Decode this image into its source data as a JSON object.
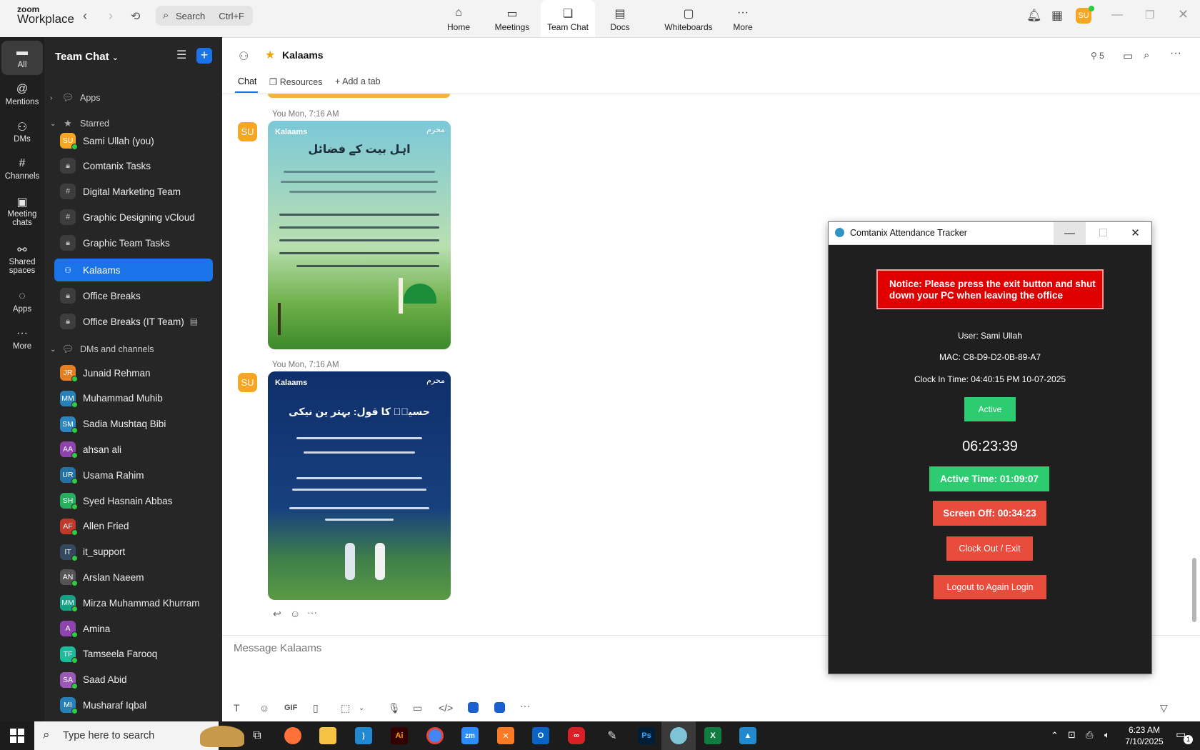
{
  "app": {
    "logo_line1": "zoom",
    "logo_line2": "Workplace"
  },
  "topbar": {
    "search_placeholder": "Search",
    "search_shortcut": "Ctrl+F",
    "nav": [
      {
        "label": "Home",
        "icon": "home-icon"
      },
      {
        "label": "Meetings",
        "icon": "video-camera-icon"
      },
      {
        "label": "Team Chat",
        "icon": "chat-bubbles-icon"
      },
      {
        "label": "Docs",
        "icon": "document-icon"
      },
      {
        "label": "Whiteboards",
        "icon": "whiteboard-icon"
      },
      {
        "label": "More",
        "icon": "more-dots-icon"
      }
    ],
    "user_initials": "SU"
  },
  "rail": [
    {
      "label": "All",
      "icon": "chat-bubble-icon"
    },
    {
      "label": "Mentions",
      "icon": "at-sign-icon"
    },
    {
      "label": "DMs",
      "icon": "people-icon"
    },
    {
      "label": "Channels",
      "icon": "hashtag-icon"
    },
    {
      "label": "Meeting chats",
      "icon": "calendar-icon"
    },
    {
      "label": "Shared spaces",
      "icon": "shared-spaces-icon"
    },
    {
      "label": "Apps",
      "icon": "apps-bubble-icon"
    },
    {
      "label": "More",
      "icon": "more-dots-icon"
    }
  ],
  "sidebar": {
    "title": "Team Chat",
    "sections": {
      "apps": "Apps",
      "starred": "Starred",
      "dms": "DMs and channels"
    },
    "starred": [
      {
        "label": "Sami Ullah (you)",
        "type": "avatar",
        "initials": "SU",
        "color": "#f5a623"
      },
      {
        "label": "Comtanix Tasks",
        "type": "lock"
      },
      {
        "label": "Digital Marketing Team",
        "type": "hash"
      },
      {
        "label": "Graphic Designing vCloud",
        "type": "hash"
      },
      {
        "label": "Graphic Team Tasks",
        "type": "lock"
      },
      {
        "label": "Kalaams",
        "type": "group"
      },
      {
        "label": "Office Breaks",
        "type": "lock"
      },
      {
        "label": "Office Breaks (IT Team)",
        "type": "lock"
      }
    ],
    "dms": [
      {
        "label": "Junaid Rehman",
        "initials": "JR",
        "color": "#e67e22"
      },
      {
        "label": "Muhammad Muhib",
        "initials": "MM",
        "color": "#2980b9"
      },
      {
        "label": "Sadia Mushtaq Bibi",
        "initials": "SM",
        "color": "#2e86c1"
      },
      {
        "label": "ahsan ali",
        "initials": "AA",
        "color": "#8e44ad"
      },
      {
        "label": "Usama Rahim",
        "initials": "UR",
        "color": "#2471a3"
      },
      {
        "label": "Syed Hasnain Abbas",
        "initials": "SH",
        "color": "#27ae60"
      },
      {
        "label": "Allen Fried",
        "initials": "AF",
        "color": "#c0392b"
      },
      {
        "label": "it_support",
        "initials": "IT",
        "color": "#34495e"
      },
      {
        "label": "Arslan Naeem",
        "initials": "AN",
        "color": "#555555"
      },
      {
        "label": "Mirza Muhammad Khurram",
        "initials": "MM",
        "color": "#16a085"
      },
      {
        "label": "Amina",
        "initials": "A",
        "color": "#8e44ad"
      },
      {
        "label": "Tamseela Farooq",
        "initials": "TF",
        "color": "#1abc9c"
      },
      {
        "label": "Saad Abid",
        "initials": "SA",
        "color": "#9b59b6"
      },
      {
        "label": "Musharaf Iqbal",
        "initials": "MI",
        "color": "#2980b9"
      }
    ]
  },
  "chat": {
    "title": "Kalaams",
    "member_count": "5",
    "tabs": [
      "Chat",
      "Resources",
      "Add a tab"
    ],
    "messages": [
      {
        "sender_initials": "SU",
        "meta": "You Mon, 7:16 AM",
        "brand": "Kalaams",
        "heading": "اہل بیت کے فضائل"
      },
      {
        "sender_initials": "SU",
        "meta": "You Mon, 7:16 AM",
        "brand": "Kalaams",
        "heading": "حسینؓ کا قول: بہتر ین نیکی"
      }
    ],
    "composer_placeholder": "Message Kalaams",
    "toolbar_gif": "GIF"
  },
  "tracker": {
    "title": "Comtanix Attendance Tracker",
    "notice": "Notice: Please press the exit button and shut down your PC when leaving the office",
    "user": "User: Sami Ullah",
    "mac": "MAC: C8-D9-D2-0B-89-A7",
    "clock_in": "Clock In Time: 04:40:15 PM 10-07-2025",
    "status": "Active",
    "clock": "06:23:39",
    "active_time": "Active Time: 01:09:07",
    "screen_off": "Screen Off: 00:34:23",
    "clock_out": "Clock Out / Exit",
    "logout": "Logout to Again Login",
    "colors": {
      "notice": "#e00000",
      "green": "#2ecc71",
      "red": "#e74c3c",
      "bg": "#1f1f1f"
    }
  },
  "taskbar": {
    "search_placeholder": "Type here to search",
    "time": "6:23 AM",
    "date": "7/10/2025",
    "notifications": "1"
  }
}
